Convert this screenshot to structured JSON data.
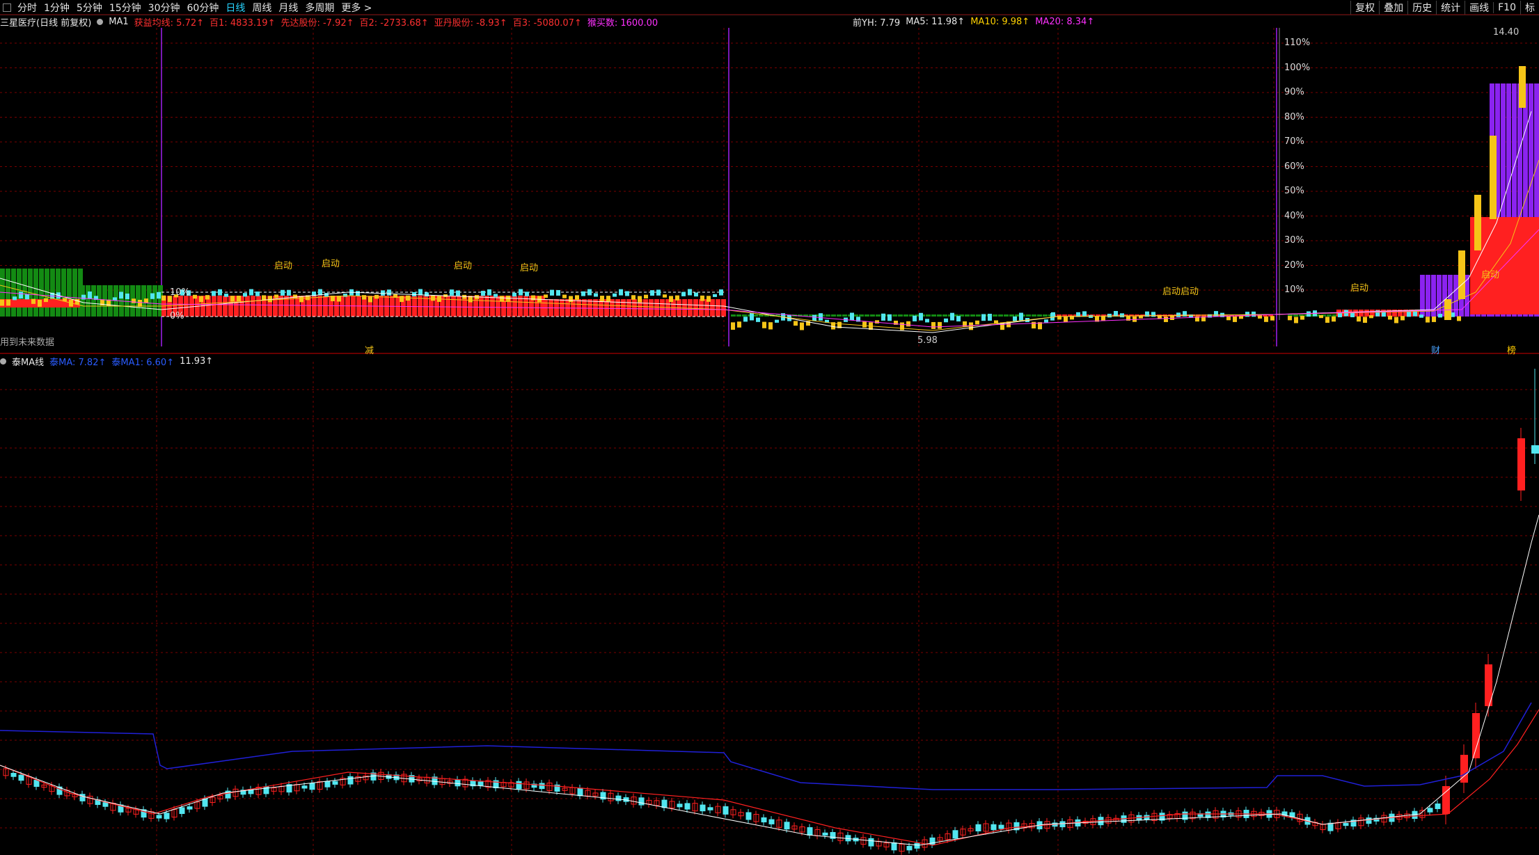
{
  "toolbar": {
    "periods": [
      "分时",
      "1分钟",
      "5分钟",
      "15分钟",
      "30分钟",
      "60分钟",
      "日线",
      "周线",
      "月线",
      "多周期",
      "更多 >"
    ],
    "active_period": "日线",
    "right_buttons": [
      "复权",
      "叠加",
      "历史",
      "统计",
      "画线",
      "F10",
      "标"
    ]
  },
  "upper": {
    "stock_title": "三星医疗(日线 前复权)",
    "indicator": "MA1",
    "items": [
      {
        "text": "获益均线: 5.72↑",
        "color": "#ff3030"
      },
      {
        "text": "百1: 4833.19↑",
        "color": "#ff3030"
      },
      {
        "text": "先达股份: -7.92↑",
        "color": "#ff3030"
      },
      {
        "text": "百2: -2733.68↑",
        "color": "#ff3030"
      },
      {
        "text": "亚丹股份: -8.93↑",
        "color": "#ff3030"
      },
      {
        "text": "百3: -5080.07↑",
        "color": "#ff3030"
      },
      {
        "text": "猴买数: 1600.00",
        "color": "#ff30ff"
      }
    ],
    "ma_items": [
      {
        "text": "前YH: 7.79",
        "color": "#e8e8e8"
      },
      {
        "text": "MA5: 11.98↑",
        "color": "#e8e8e8"
      },
      {
        "text": "MA10: 9.98↑",
        "color": "#ffd200"
      },
      {
        "text": "MA20: 8.34↑",
        "color": "#ff30ff"
      }
    ],
    "pct_labels": [
      "110%",
      "100%",
      "90%",
      "80%",
      "70%",
      "60%",
      "50%",
      "40%",
      "30%",
      "20%",
      "10%"
    ],
    "left_pct": [
      "10%",
      "0%"
    ],
    "qidong": [
      "启动",
      "启动",
      "启动",
      "启动",
      "启动启动",
      "启动",
      "启动"
    ],
    "bottom_left": "用到未来数据",
    "jian": "减",
    "low_price": "5.98",
    "cai": "财",
    "bang": "榜",
    "high_price": "14.40"
  },
  "lower": {
    "title": "泰MA线",
    "ma6": "泰MA: 7.82↑",
    "ma2": "泰MA1: 6.60↑",
    "value": "11.93↑"
  },
  "colors": {
    "up": "#ff2020",
    "down": "#52e6f0",
    "green": "#138a13",
    "purple": "#8b23f0",
    "gold": "#f5c518",
    "grid": "#7a0000",
    "blue": "#2020d8"
  }
}
